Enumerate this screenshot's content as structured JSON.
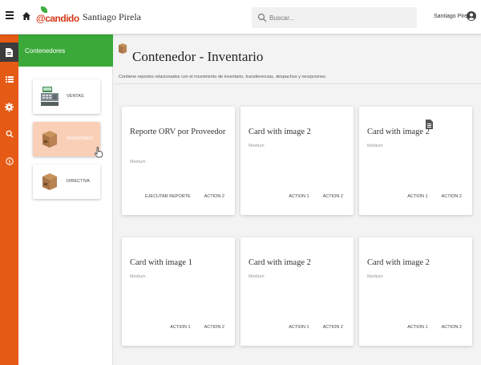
{
  "topbar": {
    "logo_text": "@candido",
    "app_name": "Santiago Pirela",
    "search_placeholder": "Buscar...",
    "user_name": "Santiago Pirela"
  },
  "rail": {
    "items": [
      {
        "icon": "document-icon",
        "active": true
      },
      {
        "icon": "list-icon",
        "active": false
      },
      {
        "icon": "gear-icon",
        "active": false
      },
      {
        "icon": "search-icon",
        "active": false
      },
      {
        "icon": "info-icon",
        "active": false
      }
    ]
  },
  "panel": {
    "title": "Contenedores",
    "items": [
      {
        "label": "VENTAS",
        "icon": "cash-register-icon",
        "active": false
      },
      {
        "label": "INVENTARIO",
        "icon": "box-icon",
        "active": true
      },
      {
        "label": "DIRECTIVA",
        "icon": "box-icon",
        "active": false
      }
    ]
  },
  "main": {
    "title": "Contenedor - Inventario",
    "description": "Contiene reportes relacionados con el movimiento de inventario, transferencias, despachos y recepciones",
    "cards": [
      {
        "title": "Reporte ORV por Proveedor",
        "subtitle": "Medium",
        "actions": [
          "EJECUTAR REPORTE",
          "ACTION 2"
        ]
      },
      {
        "title": "Card with image 2",
        "subtitle": "Medium",
        "actions": [
          "ACTION 1",
          "ACTION 2"
        ]
      },
      {
        "title": "Card with image 2",
        "subtitle": "Medium",
        "actions": [
          "ACTION 1",
          "ACTION 2"
        ],
        "icon": "document-icon"
      },
      {
        "title": "Card with image 1",
        "subtitle": "Medium",
        "actions": [
          "ACTION 1",
          "ACTION 2"
        ]
      },
      {
        "title": "Card with image 2",
        "subtitle": "Medium",
        "actions": [
          "ACTION 1",
          "ACTION 2"
        ]
      },
      {
        "title": "Card with image 2",
        "subtitle": "Medium",
        "actions": [
          "ACTION 1",
          "ACTION 2"
        ]
      }
    ]
  },
  "colors": {
    "rail": "#e55a14",
    "panel_header": "#3aa93a",
    "active_container": "#f9cfb8",
    "logo": "#d63a1a"
  }
}
